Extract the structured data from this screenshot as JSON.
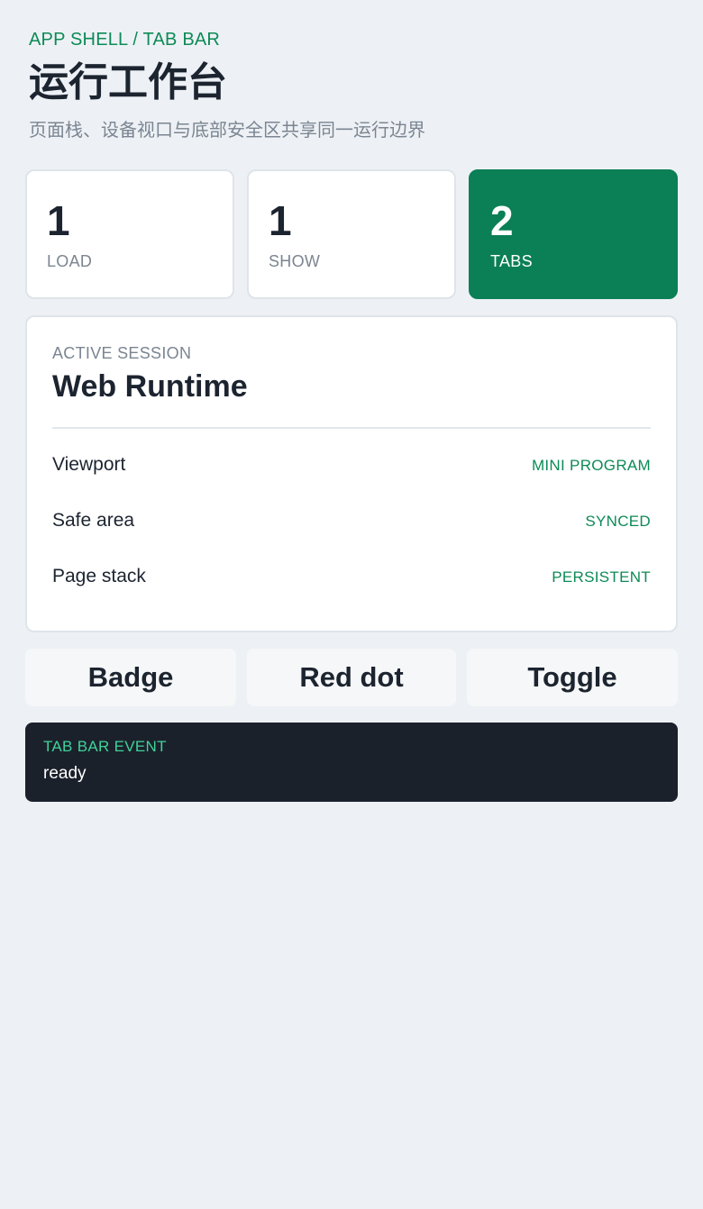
{
  "header": {
    "eyebrow": "APP SHELL / TAB BAR",
    "title": "运行工作台",
    "subtitle": "页面栈、设备视口与底部安全区共享同一运行边界"
  },
  "stats": [
    {
      "value": "1",
      "label": "LOAD"
    },
    {
      "value": "1",
      "label": "SHOW"
    },
    {
      "value": "2",
      "label": "TABS"
    }
  ],
  "session": {
    "caption": "ACTIVE SESSION",
    "name": "Web Runtime",
    "rows": [
      {
        "key": "Viewport",
        "value": "MINI PROGRAM"
      },
      {
        "key": "Safe area",
        "value": "SYNCED"
      },
      {
        "key": "Page stack",
        "value": "PERSISTENT"
      }
    ]
  },
  "actions": {
    "badge": "Badge",
    "red_dot": "Red dot",
    "toggle": "Toggle"
  },
  "event": {
    "caption": "TAB BAR EVENT",
    "value": "ready"
  },
  "colors": {
    "accent": "#0b7f55",
    "accent_text": "#0d8a56",
    "background": "#edf1f5",
    "event_bg": "#1b212b",
    "event_caption": "#3fd39a"
  }
}
